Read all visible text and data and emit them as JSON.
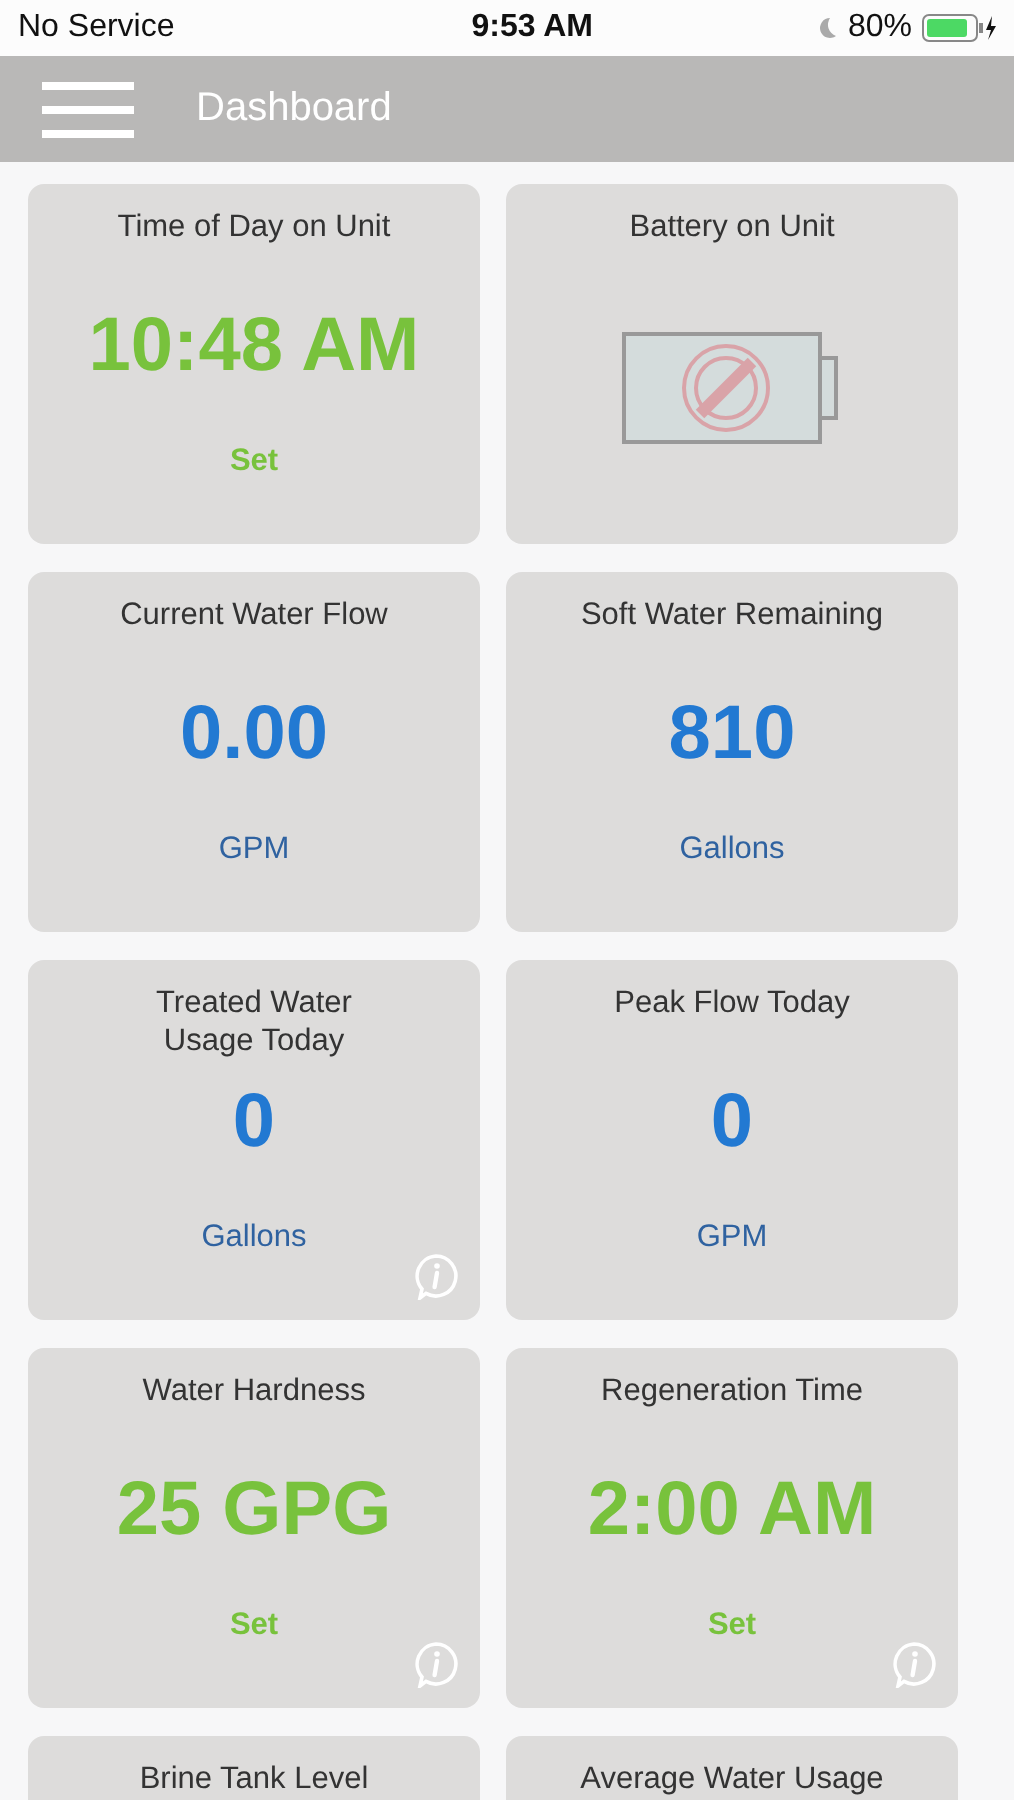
{
  "status_bar": {
    "carrier": "No Service",
    "time": "9:53 AM",
    "battery": "80%"
  },
  "header": {
    "title": "Dashboard"
  },
  "cards": [
    {
      "kind": "value",
      "title": [
        "Time of Day on Unit"
      ],
      "value": "10:48 AM",
      "color": "#78c23c",
      "footer": "Set",
      "footer_action": true,
      "info": false
    },
    {
      "kind": "battery",
      "title": [
        "Battery on Unit"
      ],
      "info": false
    },
    {
      "kind": "value",
      "title": [
        "Current Water Flow"
      ],
      "value": "0.00",
      "color": "#2279d2",
      "footer": "GPM",
      "footer_action": false,
      "info": false
    },
    {
      "kind": "value",
      "title": [
        "Soft Water Remaining"
      ],
      "value": "810",
      "color": "#2279d2",
      "footer": "Gallons",
      "footer_action": false,
      "info": false
    },
    {
      "kind": "value",
      "title": [
        "Treated Water",
        "Usage Today"
      ],
      "value": "0",
      "color": "#2279d2",
      "footer": "Gallons",
      "footer_action": false,
      "info": true
    },
    {
      "kind": "value",
      "title": [
        "Peak Flow Today"
      ],
      "value": "0",
      "color": "#2279d2",
      "footer": "GPM",
      "footer_action": false,
      "info": false
    },
    {
      "kind": "value",
      "title": [
        "Water Hardness"
      ],
      "value": "25 GPG",
      "color": "#78c23c",
      "footer": "Set",
      "footer_action": true,
      "info": true
    },
    {
      "kind": "value",
      "title": [
        "Regeneration Time"
      ],
      "value": "2:00 AM",
      "color": "#78c23c",
      "footer": "Set",
      "footer_action": true,
      "info": true
    },
    {
      "kind": "partial",
      "title": [
        "Brine Tank Level"
      ],
      "info": false
    },
    {
      "kind": "partial",
      "title": [
        "Average Water Usage"
      ],
      "info": false
    }
  ]
}
